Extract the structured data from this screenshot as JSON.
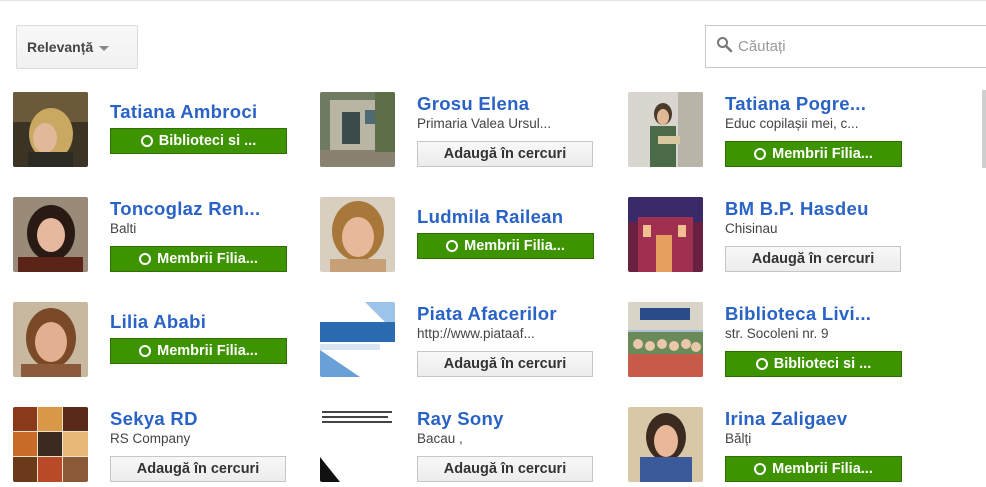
{
  "toolbar": {
    "sort_label": "Relevanță"
  },
  "search": {
    "placeholder": "Căutați"
  },
  "people": [
    {
      "name": "Tatiana Ambroci",
      "subtitle": "",
      "button": "Biblioteci si ...",
      "button_style": "green",
      "avatar": "photo-woman-blonde"
    },
    {
      "name": "Grosu Elena",
      "subtitle": "Primaria Valea Ursul...",
      "button": "Adaugă în cercuri",
      "button_style": "grey",
      "avatar": "photo-building"
    },
    {
      "name": "Tatiana Pogre...",
      "subtitle": "Educ copilașii mei, c...",
      "button": "Membrii Filia...",
      "button_style": "green",
      "avatar": "photo-woman-standing"
    },
    {
      "name": "Toncoglaz Ren...",
      "subtitle": "Balti",
      "button": "Membrii Filia...",
      "button_style": "green",
      "avatar": "photo-woman-dark-hair"
    },
    {
      "name": "Ludmila Railean",
      "subtitle": "",
      "button": "Membrii Filia...",
      "button_style": "green",
      "avatar": "photo-woman-face"
    },
    {
      "name": "BM B.P. Hasdeu",
      "subtitle": "Chisinau",
      "button": "Adaugă în cercuri",
      "button_style": "grey",
      "avatar": "photo-library-building"
    },
    {
      "name": "Lilia Ababi",
      "subtitle": "",
      "button": "Membrii Filia...",
      "button_style": "green",
      "avatar": "photo-woman-portrait"
    },
    {
      "name": "Piata Afacerilor",
      "subtitle": "http://www.piataaf...",
      "button": "Adaugă în cercuri",
      "button_style": "grey",
      "avatar": "logo-piata-afacerilor"
    },
    {
      "name": "Biblioteca Livi...",
      "subtitle": "str. Socoleni nr. 9",
      "button": "Biblioteci si ...",
      "button_style": "green",
      "avatar": "photo-group"
    },
    {
      "name": "Sekya RD",
      "subtitle": "RS Company",
      "button": "Adaugă în cercuri",
      "button_style": "grey",
      "avatar": "photo-collage"
    },
    {
      "name": "Ray Sony",
      "subtitle": "Bacau ,",
      "button": "Adaugă în cercuri",
      "button_style": "grey",
      "avatar": "photo-text-image"
    },
    {
      "name": "Irina Zaligaev",
      "subtitle": "Bălți",
      "button": "Membrii Filia...",
      "button_style": "green",
      "avatar": "photo-woman-blue"
    }
  ],
  "colors": {
    "accent_link": "#2a63c6",
    "button_green": "#3d9400"
  }
}
